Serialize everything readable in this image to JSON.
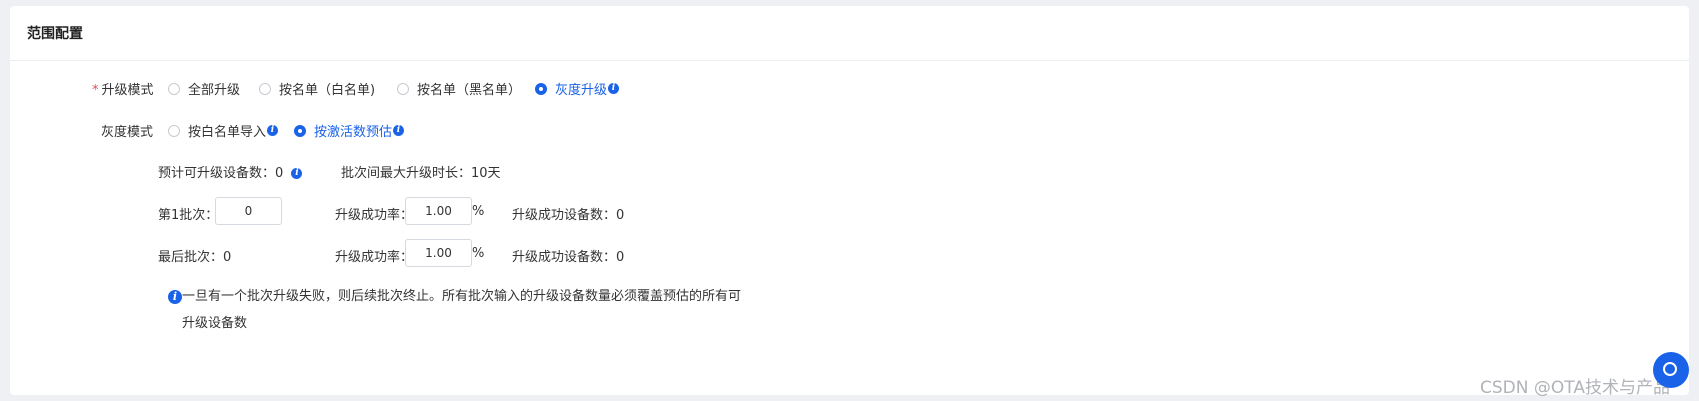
{
  "card": {
    "title": "范围配置"
  },
  "upgrade_mode": {
    "label": "升级模式",
    "required_mark": "*",
    "options": [
      {
        "label": "全部升级",
        "checked": false
      },
      {
        "label": "按名单（白名单)",
        "checked": false
      },
      {
        "label": "按名单（黑名单）",
        "checked": false
      },
      {
        "label": "灰度升级",
        "checked": true
      }
    ]
  },
  "gray_mode": {
    "label": "灰度模式",
    "options": [
      {
        "label": "按白名单导入",
        "checked": false
      },
      {
        "label": "按激活数预估",
        "checked": true
      }
    ]
  },
  "estimate": {
    "devices_label": "预计可升级设备数：",
    "devices_value": "0",
    "max_duration_label": "批次间最大升级时长：",
    "max_duration_value": "10天"
  },
  "batch_first": {
    "label": "第1批次：",
    "value": "0",
    "rate_label": "升级成功率：",
    "rate_value": "1.00",
    "percent": "%",
    "success_label": "升级成功设备数：",
    "success_value": "0"
  },
  "batch_last": {
    "label": "最后批次：",
    "value": "0",
    "rate_label": "升级成功率：",
    "rate_value": "1.00",
    "percent": "%",
    "success_label": "升级成功设备数：",
    "success_value": "0"
  },
  "notice": {
    "line1": "一旦有一个批次升级失败，则后续批次终止。所有批次输入的升级设备数量必须覆盖预估的所有可",
    "line2": "升级设备数"
  },
  "watermark": "CSDN @OTA技术与产品",
  "colors": {
    "accent": "#1a62e8",
    "required": "#e34d59"
  },
  "icons": {
    "info": "info-icon",
    "help": "help-chat-icon"
  }
}
